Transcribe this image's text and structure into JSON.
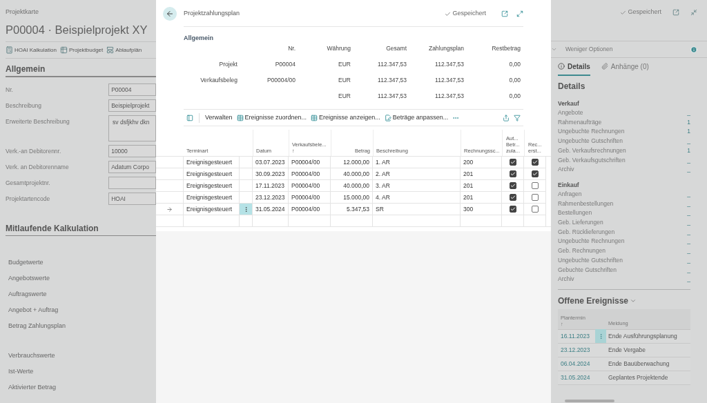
{
  "page": {
    "breadcrumb": "Projektkarte",
    "title": "P00004 · Beispielprojekt XY",
    "status": "Gespeichert",
    "actions": [
      {
        "label": "HOAI Kalkulation",
        "kind": "calc"
      },
      {
        "label": "Projektbudget",
        "kind": "budget"
      },
      {
        "label": "Ablaufplän",
        "kind": "plan"
      }
    ],
    "section_general": "Allgemein",
    "fields": [
      {
        "label": "Nr.",
        "value": "P00004",
        "kind": "input"
      },
      {
        "label": "Beschreibung",
        "value": "Beispielprojekt",
        "kind": "input"
      },
      {
        "label": "Erweiterte Beschreibung",
        "value": "sv dsfjkhv dkn",
        "kind": "textarea"
      },
      {
        "label": "Verk.-an Debitorennr.",
        "value": "10000",
        "kind": "input"
      },
      {
        "label": "Verk. an Debitorenname",
        "value": "Adatum Corpo",
        "kind": "input"
      },
      {
        "label": "Gesamtprojektnr.",
        "kind": "input"
      },
      {
        "label": "Projektartencode",
        "value": "HOAI",
        "kind": "input"
      }
    ],
    "section_calc": "Mitlaufende Kalkulation",
    "calc_groups": [
      [
        "Budgetwerte",
        "Angebotswerte",
        "Auftragswerte",
        "Angebot + Auftrag",
        "Betrag Zahlungsplan"
      ],
      [
        "Verbrauchswerte",
        "Ist-Werte",
        "Aktivierter Betrag"
      ]
    ]
  },
  "factbox": {
    "options_label": "Weniger Optionen",
    "tabs": [
      {
        "label": "Details",
        "selected": true,
        "kind": "info"
      },
      {
        "label": "Anhänge (0)",
        "selected": false,
        "kind": "clip"
      }
    ],
    "heading": "Details",
    "groups": [
      {
        "title": "Verkauf",
        "rows": [
          {
            "label": "Angebote",
            "value": "_"
          },
          {
            "label": "Rahmenaufträge",
            "value": "1"
          },
          {
            "label": "Ungebuchte Rechnungen",
            "value": "1"
          },
          {
            "label": "Ungebuchte Gutschriften",
            "value": "_"
          },
          {
            "label": "Geb. Verkaufsrechnungen",
            "value": "1"
          },
          {
            "label": "Geb. Verkaufsgutschriften",
            "value": "_"
          },
          {
            "label": "Archiv",
            "value": "_"
          }
        ]
      },
      {
        "title": "Einkauf",
        "rows": [
          {
            "label": "Anfragen",
            "value": "_"
          },
          {
            "label": "Rahmenbestellungen",
            "value": "_"
          },
          {
            "label": "Bestellungen",
            "value": "_"
          },
          {
            "label": "Geb. Lieferungen",
            "value": "_"
          },
          {
            "label": "Geb. Rücklieferungen",
            "value": "_"
          },
          {
            "label": "Ungebuchte Rechnungen",
            "value": "_"
          },
          {
            "label": "Geb. Rechnungen",
            "value": "_"
          },
          {
            "label": "Ungebuchte Gutschriften",
            "value": "_"
          },
          {
            "label": "Gebuchte Gutschriften",
            "value": "_"
          },
          {
            "label": "Archiv",
            "value": "_"
          }
        ]
      }
    ],
    "events": {
      "title": "Offene Ereignisse",
      "date_header": "Plantermin",
      "sort_mark": "↑",
      "message_header": "Meldung",
      "rows": [
        {
          "date": "16.11.2023",
          "message": "Ende Ausführungsplanung",
          "selected": true
        },
        {
          "date": "23.12.2023",
          "message": "Ende Vergabe",
          "selected": false
        },
        {
          "date": "06.04.2024",
          "message": "Ende Bauüberwachung",
          "selected": false
        },
        {
          "date": "31.05.2024",
          "message": "Geplantes Projektende",
          "selected": false
        }
      ]
    }
  },
  "dialog": {
    "title": "Projektzahlungsplan",
    "status": "Gespeichert",
    "section": "Allgemein",
    "summary_columns": [
      "Nr.",
      "Währung",
      "Gesamt",
      "Zahlungsplan",
      "Restbetrag"
    ],
    "summary_rows": [
      {
        "label": "Projekt",
        "cells": [
          "P00004",
          "EUR",
          "112.347,53",
          "112.347,53",
          "0,00"
        ]
      },
      {
        "label": "Verkaufsbeleg",
        "cells": [
          "P00004/00",
          "EUR",
          "112.347,53",
          "112.347,53",
          "0,00"
        ]
      },
      {
        "label": "",
        "cells": [
          "",
          "EUR",
          "112.347,53",
          "112.347,53",
          "0,00"
        ]
      }
    ],
    "toolbar": [
      {
        "label": "Verwalten",
        "kind": "text"
      },
      {
        "label": "Ereignisse zuordnen...",
        "kind": "table"
      },
      {
        "label": "Ereignisse anzeigen...",
        "kind": "table"
      },
      {
        "label": "Beträge anpassen...",
        "kind": "edit"
      }
    ],
    "columns": [
      {
        "label": "Terminart"
      },
      {
        "label": "Datum"
      },
      {
        "label": "Verkaufsbele...",
        "sort_mark": "↑"
      },
      {
        "label": "Betrag"
      },
      {
        "label": "Beschreibung"
      },
      {
        "label": "Rechnungssc..."
      },
      {
        "label": "Aut... Betr... zula..."
      },
      {
        "label": "Rec... erst..."
      }
    ],
    "rows": [
      {
        "type": "Ereignisgesteuert",
        "date": "03.07.2023",
        "doc": "P00004/00",
        "amount": "12.000,00",
        "description": "1. AR",
        "scheme": "200",
        "auto": true,
        "invoiced": true,
        "current": false
      },
      {
        "type": "Ereignisgesteuert",
        "date": "30.09.2023",
        "doc": "P00004/00",
        "amount": "40.000,00",
        "description": "2. AR",
        "scheme": "201",
        "auto": true,
        "invoiced": true,
        "current": false
      },
      {
        "type": "Ereignisgesteuert",
        "date": "17.11.2023",
        "doc": "P00004/00",
        "amount": "40.000,00",
        "description": "3. AR",
        "scheme": "201",
        "auto": true,
        "invoiced": false,
        "current": false
      },
      {
        "type": "Ereignisgesteuert",
        "date": "23.12.2023",
        "doc": "P00004/00",
        "amount": "15.000,00",
        "description": "4. AR",
        "scheme": "201",
        "auto": true,
        "invoiced": false,
        "current": false
      },
      {
        "type": "Ereignisgesteuert",
        "date": "31.05.2024",
        "doc": "P00004/00",
        "amount": "5.347,53",
        "description": "SR",
        "scheme": "300",
        "auto": true,
        "invoiced": false,
        "current": true
      }
    ]
  }
}
